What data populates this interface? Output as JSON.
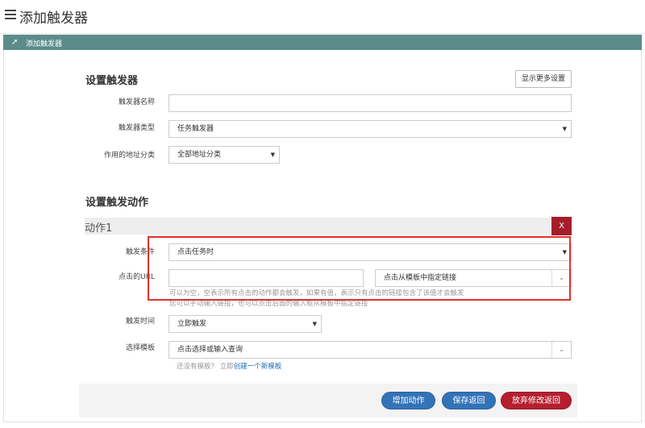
{
  "page": {
    "title": "添加触发器"
  },
  "panel": {
    "title": "添加触发器"
  },
  "settings": {
    "title": "设置触发器",
    "more_button": "显示更多设置",
    "name_label": "触发器名称",
    "name_value": "",
    "type_label": "触发器类型",
    "type_value": "任务触发器",
    "category_label": "作用的地址分类",
    "category_value": "全部地址分类"
  },
  "actions": {
    "title": "设置触发动作",
    "action1": {
      "title": "动作1",
      "delete_label": "X",
      "condition_label": "触发条件",
      "condition_value": "点击任务时",
      "url_label": "点击的URL",
      "url_value": "",
      "url_source_value": "点击从模板中指定链接",
      "url_help_1": "可以为空，空表示所有点击的动作都会触发，如果有值，表示只有点击的链接包含了该值才会触发",
      "url_help_2": "您可以手动输入链接，也可以点击后面的输入框从模板中指定链接",
      "time_label": "触发时间",
      "time_value": "立即触发",
      "template_label": "选择模板",
      "template_value": "点击选择或输入查询",
      "template_help_prefix": "还没有模板？ 立即",
      "template_help_link": "创建一个新模板"
    }
  },
  "footer": {
    "add_action": "增加动作",
    "save_return": "保存返回",
    "discard_return": "放弃修改返回"
  },
  "colors": {
    "panel_bar": "#5a8d8a",
    "primary": "#3273b8",
    "danger": "#b51f2e",
    "highlight_box": "#e0332c"
  }
}
